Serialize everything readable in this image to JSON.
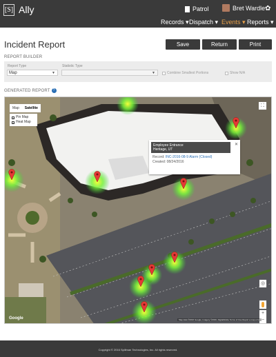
{
  "app": {
    "logo": "[S]",
    "name": "Ally"
  },
  "header": {
    "patrol_label": "Patrol",
    "user_name": "Bret Wardle"
  },
  "nav": [
    "Records ▾",
    "Dispatch ▾",
    "Events ▾",
    "Reports ▾"
  ],
  "page": {
    "title": "Incident Report"
  },
  "actions": {
    "save": "Save",
    "return": "Return",
    "print": "Print"
  },
  "builder": {
    "section_label": "REPORT BUILDER",
    "report_type_label": "Report Type",
    "report_type_value": "Map",
    "statistic_type_label": "Statistic Type",
    "statistic_type_value": "",
    "combine_label": "Combine Smallest Portions",
    "show_na_label": "Show N/A"
  },
  "generated": {
    "section_label": "GENERATED REPORT",
    "help": "?"
  },
  "map": {
    "type_map": "Map",
    "type_satellite": "Satellite",
    "layer_pin": "Pin Map",
    "layer_heat": "Heat Map",
    "popup_title": "Employee Entrance",
    "popup_subtitle": "Heritage, UT",
    "popup_record_label": "Record:",
    "popup_record_value": "INC-2016-08-9 Alarm (Closed)",
    "popup_created": "Created: 08/24/2016",
    "google": "Google",
    "attribution": "Map data ©2016 Google, Imagery ©2016, DigitalGlobe  Terms of Use  Report a map error"
  },
  "footer": {
    "copyright": "Copyright © 2016 Spillman Technologies, Inc. All rights reserved."
  },
  "colors": {
    "topbar": "#3a3a3a",
    "active_nav": "#e8a04a",
    "pin": "#e53935",
    "heat": "#7cff3a"
  }
}
